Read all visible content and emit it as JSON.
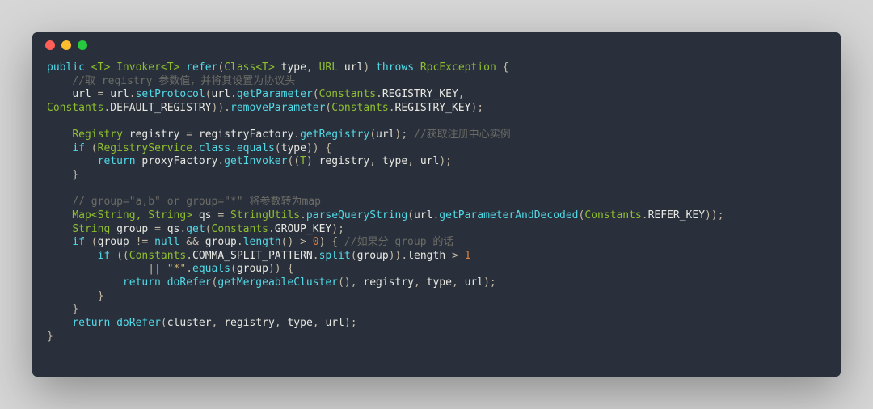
{
  "window": {
    "dots": [
      "red",
      "yellow",
      "green"
    ]
  },
  "code": {
    "l1": {
      "kw1": "public",
      "gen": "<T>",
      "type1": "Invoker",
      "gen2": "<T>",
      "m": "refer",
      "p1t": "Class",
      "p1g": "<T>",
      "p1n": "type",
      "p2t": "URL",
      "p2n": "url",
      "throws": "throws",
      "exc": "RpcException",
      "ob": "{"
    },
    "l2": {
      "c": "//取 registry 参数值，并将其设置为协议头"
    },
    "l3": {
      "a": "url",
      "op": "=",
      "b": "url",
      "m1": "setProtocol",
      "c": "url",
      "m2": "getParameter",
      "d": "Constants",
      "e": "REGISTRY_KEY"
    },
    "l4": {
      "a": "Constants",
      "b": "DEFAULT_REGISTRY",
      "m": "removeParameter",
      "c": "Constants",
      "d": "REGISTRY_KEY"
    },
    "l5": "",
    "l6": {
      "t": "Registry",
      "v": "registry",
      "f": "registryFactory",
      "m": "getRegistry",
      "arg": "url",
      "c": "//获取注册中心实例"
    },
    "l7": {
      "kw": "if",
      "a": "RegistryService",
      "b": "class",
      "m": "equals",
      "arg": "type"
    },
    "l8": {
      "kw": "return",
      "a": "proxyFactory",
      "m": "getInvoker",
      "cast": "T",
      "v1": "registry",
      "v2": "type",
      "v3": "url"
    },
    "l9": {
      "cb": "}"
    },
    "l10": "",
    "l11": {
      "c": "// group=\"a,b\" or group=\"*\" 将参数转为map"
    },
    "l12": {
      "t": "Map",
      "g": "<String, String>",
      "v": "qs",
      "a": "StringUtils",
      "m1": "parseQueryString",
      "b": "url",
      "m2": "getParameterAndDecoded",
      "c": "Constants",
      "d": "REFER_KEY"
    },
    "l13": {
      "t": "String",
      "v": "group",
      "a": "qs",
      "m": "get",
      "b": "Constants",
      "c": "GROUP_KEY"
    },
    "l14": {
      "kw": "if",
      "a": "group",
      "op1": "!=",
      "nul": "null",
      "op2": "&&",
      "b": "group",
      "m": "length",
      "op3": ">",
      "n": "0",
      "c": "//如果分 group 的话"
    },
    "l15": {
      "kw": "if",
      "a": "Constants",
      "b": "COMMA_SPLIT_PATTERN",
      "m": "split",
      "arg": "group",
      "prop": "length",
      "op": ">",
      "n": "1"
    },
    "l16": {
      "op": "||",
      "s": "\"*\"",
      "m": "equals",
      "arg": "group"
    },
    "l17": {
      "kw": "return",
      "m1": "doRefer",
      "m2": "getMergeableCluster",
      "a": "registry",
      "b": "type",
      "c": "url"
    },
    "l18": {
      "cb": "}"
    },
    "l19": {
      "cb": "}"
    },
    "l20": {
      "kw": "return",
      "m": "doRefer",
      "a": "cluster",
      "b": "registry",
      "c": "type",
      "d": "url"
    },
    "l21": {
      "cb": "}"
    }
  }
}
